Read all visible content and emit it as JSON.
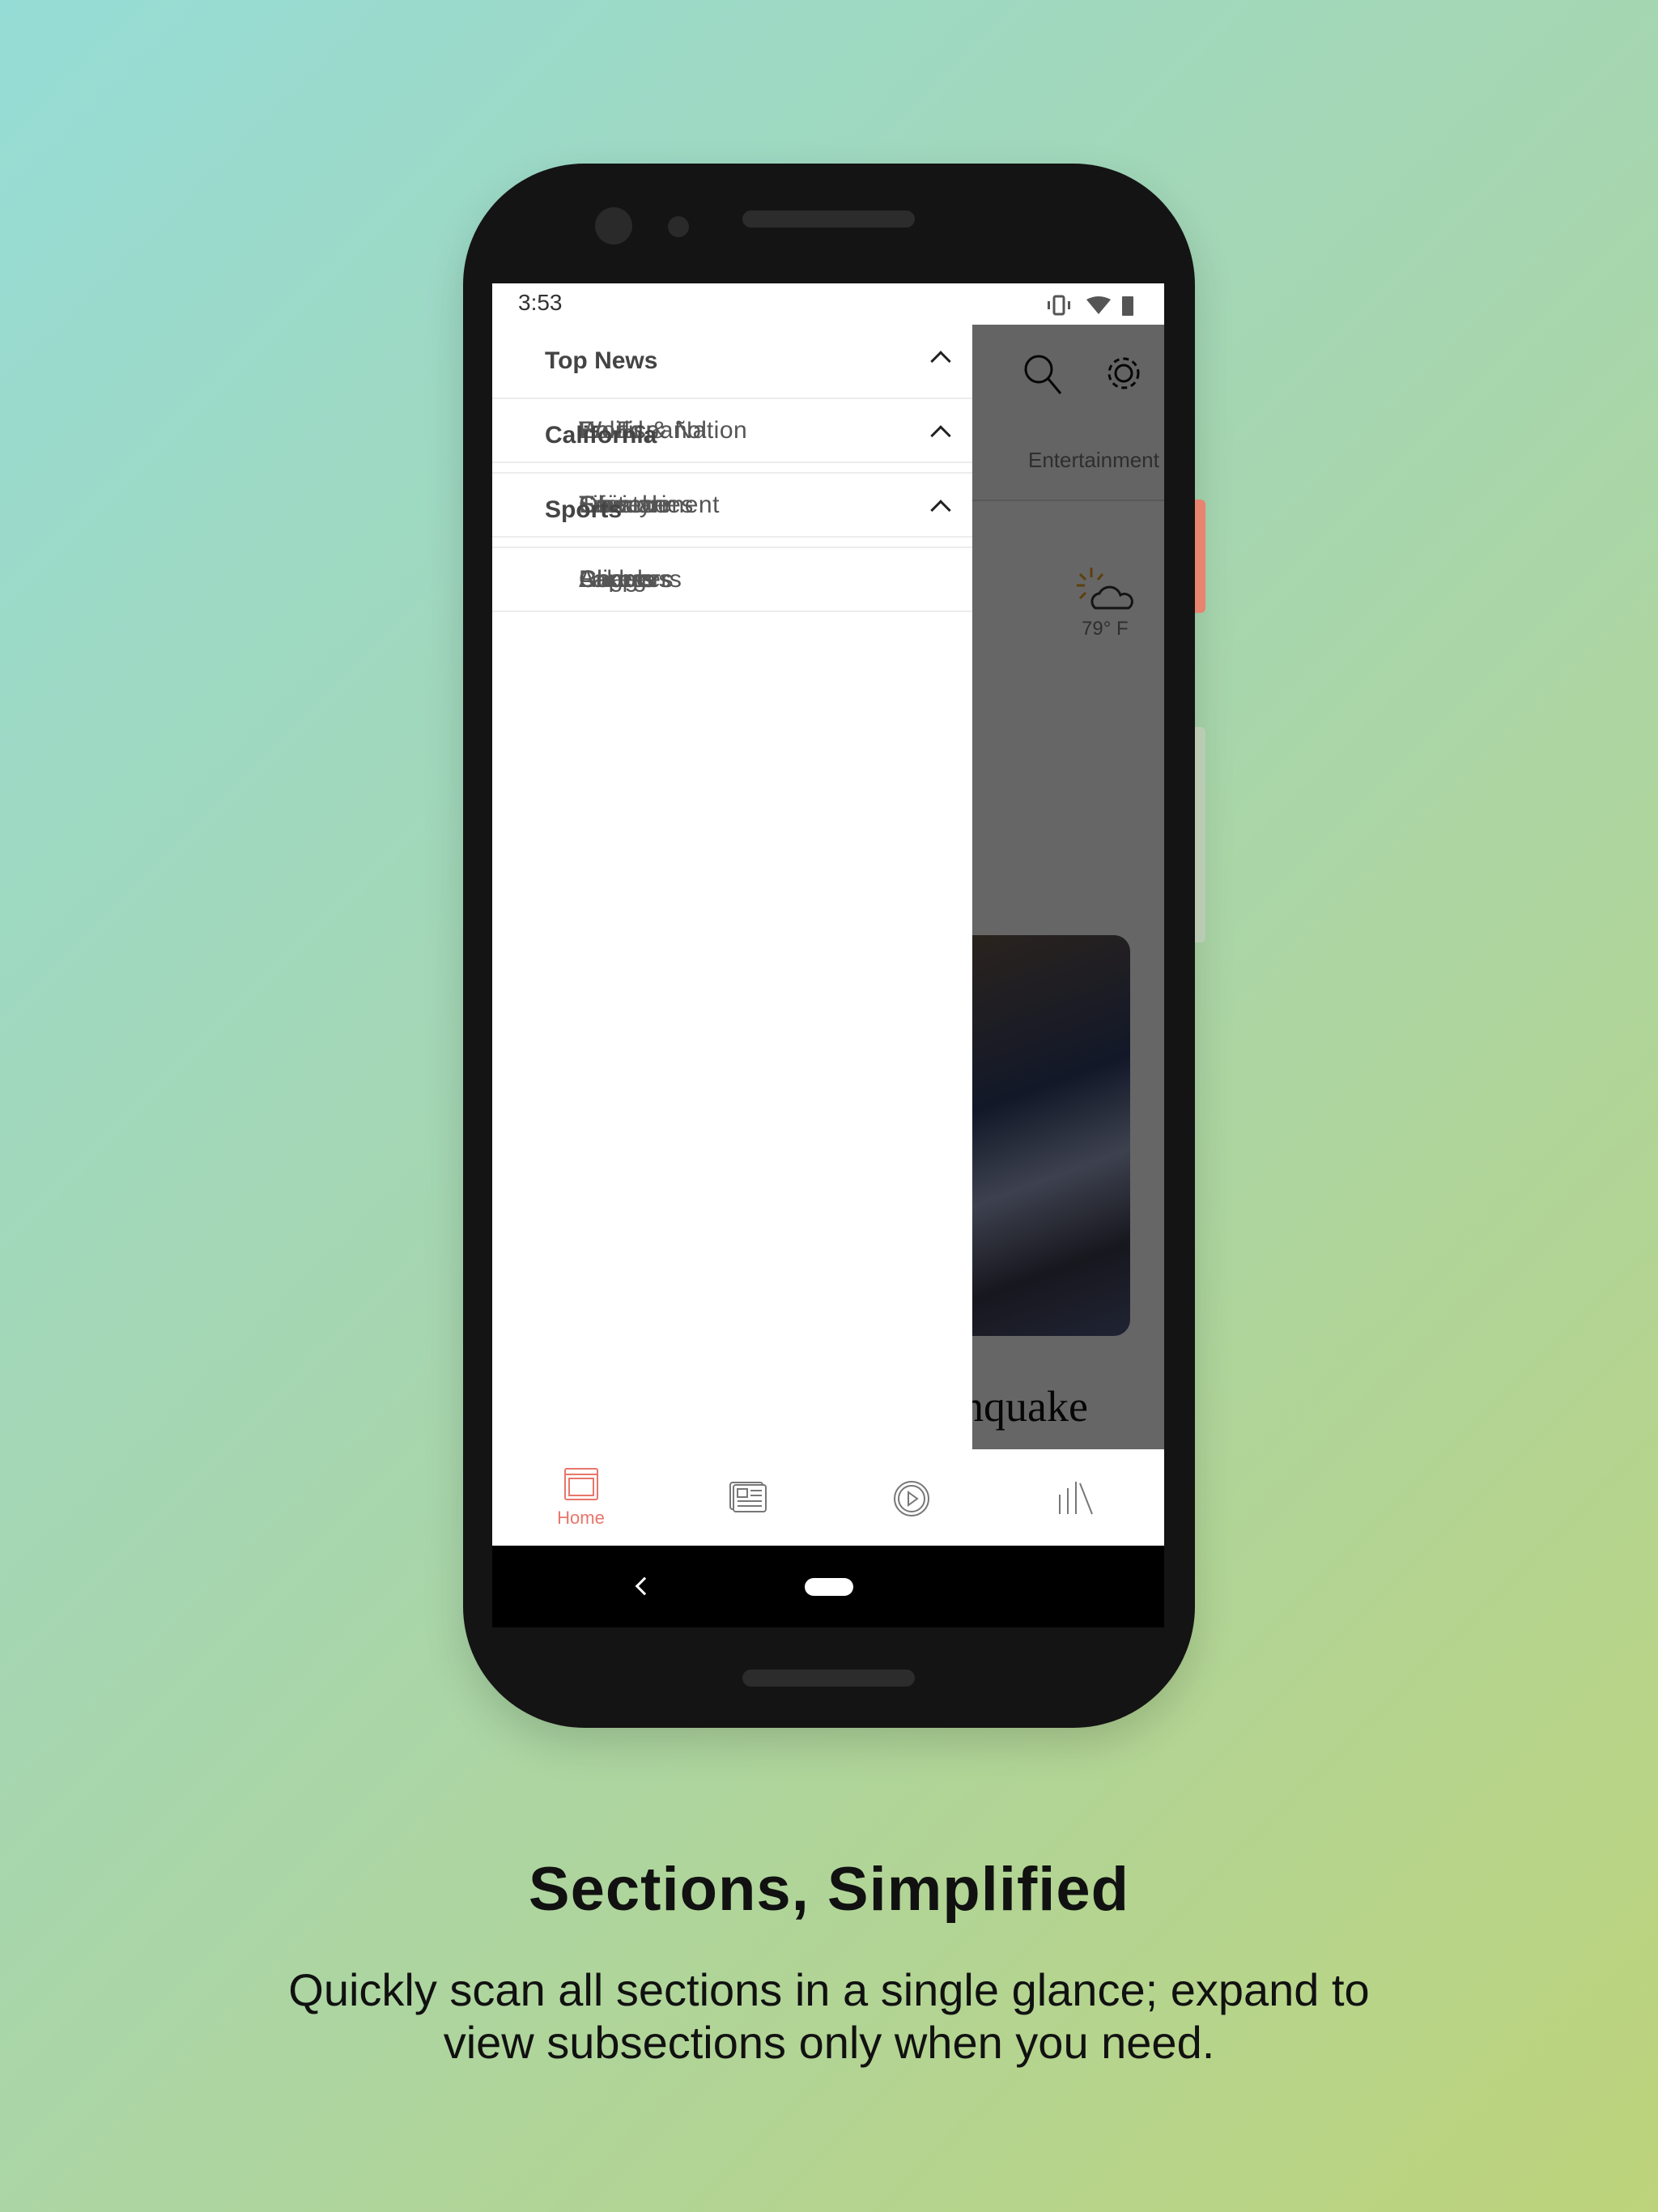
{
  "status_bar": {
    "time": "3:53",
    "icons": [
      "vibrate-icon",
      "wifi-icon",
      "battery-icon"
    ]
  },
  "background_app": {
    "tab_visible": "Entertainment",
    "weather": {
      "temp": "79° F",
      "icon": "partly-sunny-icon"
    },
    "headline_fragment": "hquake",
    "icons": [
      "search-icon",
      "gear-icon",
      "more-icon"
    ]
  },
  "drawer": {
    "sections": [
      {
        "label": "Top News",
        "expanded": true,
        "items": [
          "Politics",
          "World & Nation",
          "En Español"
        ]
      },
      {
        "label": "California",
        "expanded": true,
        "items": [
          "Environment",
          "Lifestyle",
          "Obituaries",
          "Science",
          "Travel"
        ]
      },
      {
        "label": "Sports",
        "expanded": true,
        "items": [
          "Angels",
          "Chargers",
          "Clippers",
          "Dodgers",
          "Lakers",
          "Rams"
        ]
      }
    ]
  },
  "bottom_nav": {
    "items": [
      {
        "label": "Home",
        "icon": "home-icon",
        "active": true
      },
      {
        "label": "",
        "icon": "newspaper-icon"
      },
      {
        "label": "",
        "icon": "play-icon"
      },
      {
        "label": "",
        "icon": "library-icon"
      }
    ],
    "accent": "#e8766b"
  },
  "caption": {
    "title": "Sections, Simplified",
    "line1": "Quickly scan all sections in a single glance; expand to",
    "line2": "view subsections only when you need."
  }
}
